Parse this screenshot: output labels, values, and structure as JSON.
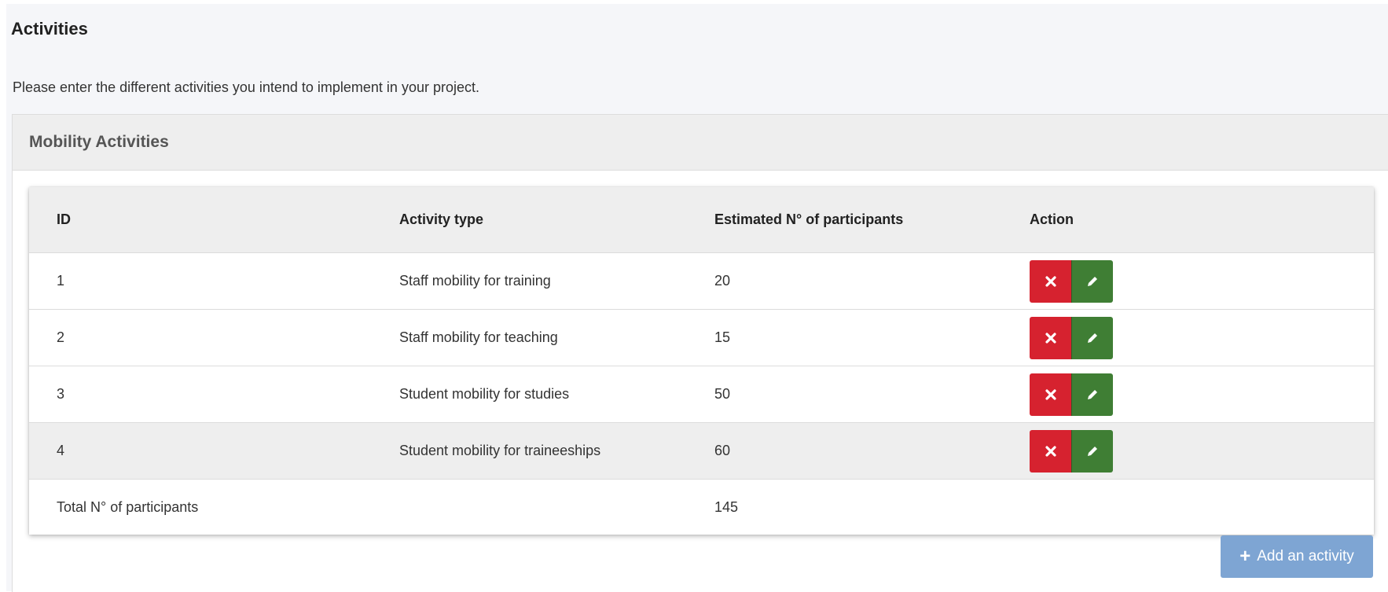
{
  "page": {
    "title": "Activities",
    "description": "Please enter the different activities you intend to implement in your project."
  },
  "panel": {
    "title": "Mobility Activities"
  },
  "table": {
    "headers": {
      "id": "ID",
      "activity_type": "Activity type",
      "participants": "Estimated N° of participants",
      "action": "Action"
    },
    "rows": [
      {
        "id": "1",
        "activity_type": "Staff mobility for training",
        "participants": "20"
      },
      {
        "id": "2",
        "activity_type": "Staff mobility for teaching",
        "participants": "15"
      },
      {
        "id": "3",
        "activity_type": "Student mobility for studies",
        "participants": "50"
      },
      {
        "id": "4",
        "activity_type": "Student mobility for traineeships",
        "participants": "60"
      }
    ],
    "total": {
      "label": "Total N° of participants",
      "value": "145"
    },
    "row_actions": {
      "delete_icon": "close-icon",
      "edit_icon": "pencil-icon"
    }
  },
  "add_button": {
    "icon": "plus",
    "label": "Add an activity"
  },
  "colors": {
    "delete": "#d6222f",
    "edit": "#3f7e34",
    "add_button": "#7ea5d3",
    "highlight_row": "#eeeeee"
  }
}
